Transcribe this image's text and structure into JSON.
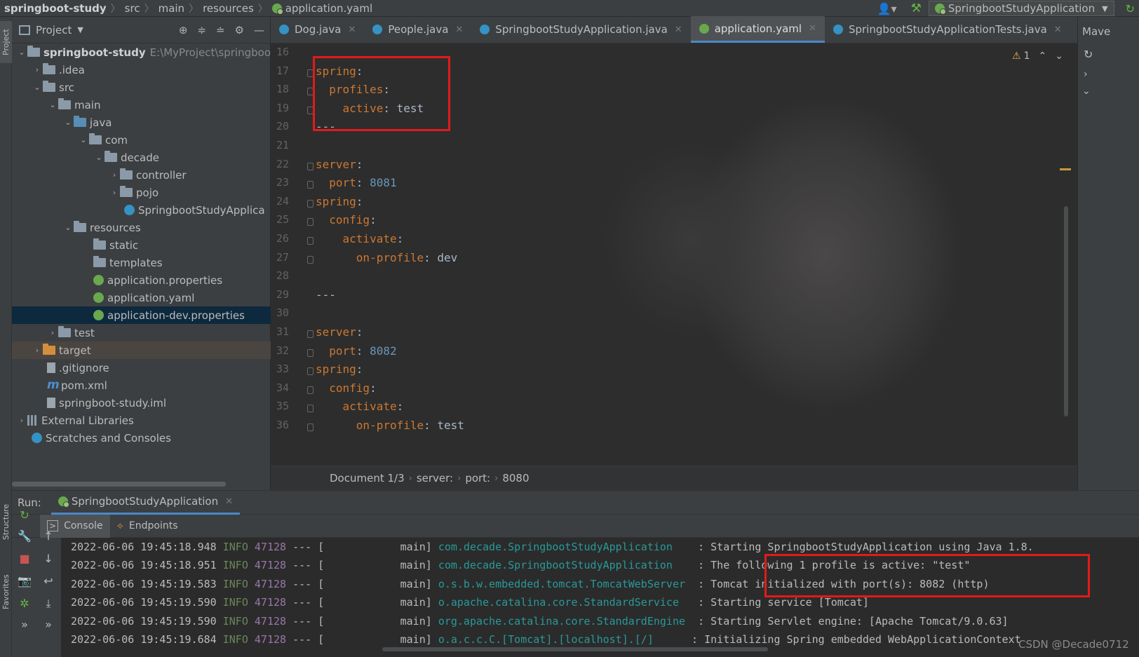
{
  "navbar": {
    "crumbs": [
      "springboot-study",
      "src",
      "main",
      "resources",
      "application.yaml"
    ],
    "run_config": "SpringbootStudyApplication"
  },
  "left_strip": {
    "project_label": "Project",
    "structure_label": "Structure",
    "favorites_label": "Favorites"
  },
  "project": {
    "header": "Project",
    "root_name": "springboot-study",
    "root_path": "E:\\MyProject\\springboo",
    "items": [
      {
        "label": ".idea"
      },
      {
        "label": "src"
      },
      {
        "label": "main"
      },
      {
        "label": "java"
      },
      {
        "label": "com"
      },
      {
        "label": "decade"
      },
      {
        "label": "controller"
      },
      {
        "label": "pojo"
      },
      {
        "label": "SpringbootStudyApplica"
      },
      {
        "label": "resources"
      },
      {
        "label": "static"
      },
      {
        "label": "templates"
      },
      {
        "label": "application.properties"
      },
      {
        "label": "application.yaml"
      },
      {
        "label": "application-dev.properties"
      },
      {
        "label": "test"
      },
      {
        "label": "target"
      },
      {
        "label": ".gitignore"
      },
      {
        "label": "pom.xml"
      },
      {
        "label": "springboot-study.iml"
      },
      {
        "label": "External Libraries"
      },
      {
        "label": "Scratches and Consoles"
      }
    ]
  },
  "tabs": [
    "Dog.java",
    "People.java",
    "SpringbootStudyApplication.java",
    "application.yaml",
    "SpringbootStudyApplicationTests.java"
  ],
  "maven_label": "Mave",
  "editor": {
    "warning_count": "1",
    "line_numbers": [
      "16",
      "17",
      "18",
      "19",
      "20",
      "21",
      "22",
      "23",
      "24",
      "25",
      "26",
      "27",
      "28",
      "29",
      "30",
      "31",
      "32",
      "33",
      "34",
      "35",
      "36"
    ],
    "lines": [
      {
        "key": "",
        "val": ""
      },
      {
        "key": "spring",
        "val": ""
      },
      {
        "key": "  profiles",
        "val": ""
      },
      {
        "key": "    active",
        "val": " test"
      },
      {
        "key": "",
        "val": "---"
      },
      {
        "key": "",
        "val": ""
      },
      {
        "key": "server",
        "val": ""
      },
      {
        "key": "  port",
        "val": " 8081"
      },
      {
        "key": "spring",
        "val": ""
      },
      {
        "key": "  config",
        "val": ""
      },
      {
        "key": "    activate",
        "val": ""
      },
      {
        "key": "      on-profile",
        "val": " dev"
      },
      {
        "key": "",
        "val": ""
      },
      {
        "key": "",
        "val": "---"
      },
      {
        "key": "",
        "val": ""
      },
      {
        "key": "server",
        "val": ""
      },
      {
        "key": "  port",
        "val": " 8082"
      },
      {
        "key": "spring",
        "val": ""
      },
      {
        "key": "  config",
        "val": ""
      },
      {
        "key": "    activate",
        "val": ""
      },
      {
        "key": "      on-profile",
        "val": " test"
      }
    ],
    "breadcrumb": [
      "Document 1/3",
      "server:",
      "port:",
      "8080"
    ]
  },
  "run": {
    "label": "Run:",
    "tab": "SpringbootStudyApplication",
    "subtabs": [
      "Console",
      "Endpoints"
    ],
    "logs": [
      {
        "ts": "2022-06-06 19:45:18.948",
        "level": "INFO",
        "pid": "47128",
        "sep": "--- [",
        "thread": "           main]",
        "logger": "com.decade.SpringbootStudyApplication",
        "msg": "    : Starting SpringbootStudyApplication using Java 1.8."
      },
      {
        "ts": "2022-06-06 19:45:18.951",
        "level": "INFO",
        "pid": "47128",
        "sep": "--- [",
        "thread": "           main]",
        "logger": "com.decade.SpringbootStudyApplication",
        "msg": "    : The following 1 profile is active: \"test\""
      },
      {
        "ts": "2022-06-06 19:45:19.583",
        "level": "INFO",
        "pid": "47128",
        "sep": "--- [",
        "thread": "           main]",
        "logger": "o.s.b.w.embedded.tomcat.TomcatWebServer",
        "msg": "  : Tomcat initialized with port(s): 8082 (http)"
      },
      {
        "ts": "2022-06-06 19:45:19.590",
        "level": "INFO",
        "pid": "47128",
        "sep": "--- [",
        "thread": "           main]",
        "logger": "o.apache.catalina.core.StandardService",
        "msg": "   : Starting service [Tomcat]"
      },
      {
        "ts": "2022-06-06 19:45:19.590",
        "level": "INFO",
        "pid": "47128",
        "sep": "--- [",
        "thread": "           main]",
        "logger": "org.apache.catalina.core.StandardEngine",
        "msg": "  : Starting Servlet engine: [Apache Tomcat/9.0.63]"
      },
      {
        "ts": "2022-06-06 19:45:19.684",
        "level": "INFO",
        "pid": "47128",
        "sep": "--- [",
        "thread": "           main]",
        "logger": "o.a.c.c.C.[Tomcat].[localhost].[/]",
        "msg": "      : Initializing Spring embedded WebApplicationContext"
      }
    ]
  },
  "watermark": "CSDN @Decade0712",
  "colors": {
    "highlight_box": "#e21a1a",
    "accent": "#4a88c7",
    "yaml_key": "#cc7832",
    "number": "#6897bb",
    "logger": "#299999"
  }
}
